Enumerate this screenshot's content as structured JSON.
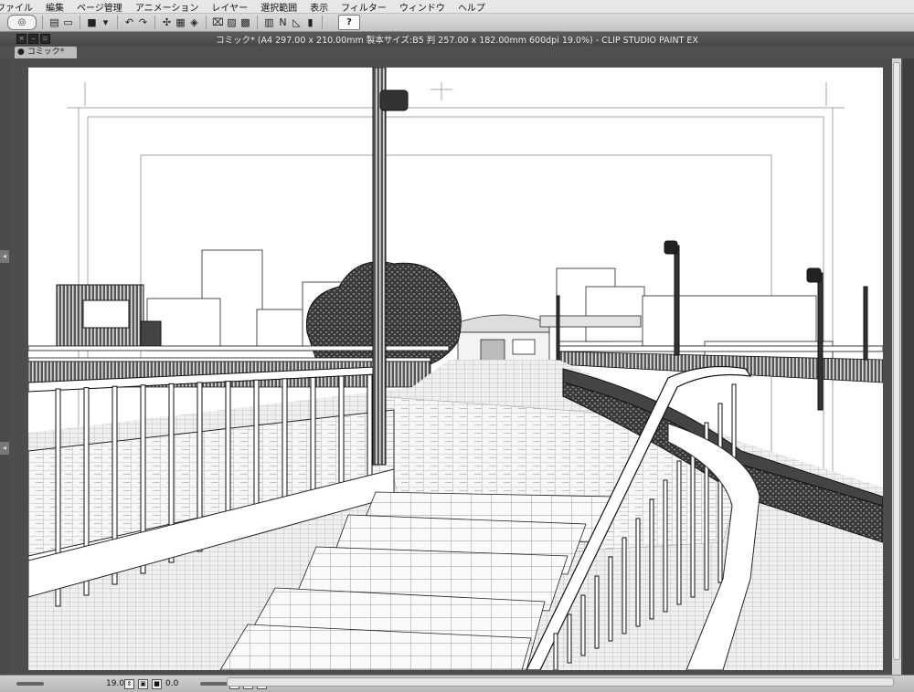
{
  "menu": [
    "ファイル",
    "編集",
    "ページ管理",
    "アニメーション",
    "レイヤー",
    "選択範囲",
    "表示",
    "フィルター",
    "ウィンドウ",
    "ヘルプ"
  ],
  "toolbar": {
    "items": [
      {
        "name": "new-file-icon",
        "glyph": "▤"
      },
      {
        "name": "open-folder-icon",
        "glyph": "▭"
      },
      {
        "name": "save-icon",
        "glyph": "■"
      },
      {
        "name": "save-dropdown-icon",
        "glyph": "▾"
      },
      {
        "name": "undo-icon",
        "glyph": "↶"
      },
      {
        "name": "redo-icon",
        "glyph": "↷"
      },
      {
        "name": "selection-launcher-icon",
        "glyph": "✣"
      },
      {
        "name": "transform-icon",
        "glyph": "▦"
      },
      {
        "name": "fill-bucket-icon",
        "glyph": "◈"
      },
      {
        "name": "deselect-icon",
        "glyph": "⌧"
      },
      {
        "name": "clear-icon",
        "glyph": "▨"
      },
      {
        "name": "fill-icon",
        "glyph": "▩"
      },
      {
        "name": "layer-icon",
        "glyph": "▥"
      },
      {
        "name": "snap-ruler-icon",
        "glyph": "N"
      },
      {
        "name": "snap-guide-icon",
        "glyph": "◺"
      },
      {
        "name": "snap-special-ruler-icon",
        "glyph": "▮"
      }
    ],
    "help_label": "?"
  },
  "window": {
    "title": "コミック* (A4 297.00 x 210.00mm 製本サイズ:B5 判 257.00 x 182.00mm 600dpi 19.0%)  - CLIP STUDIO PAINT EX"
  },
  "tabs": [
    {
      "label": "● コミック*"
    }
  ],
  "status": {
    "zoom": "19.0",
    "angle": "0.0"
  },
  "colors": {
    "menubar": "#e9e6e6",
    "titlebar": "#4f4f4f",
    "workspace": "#4d4d4d",
    "page": "#ffffff",
    "frame_lines": "#8a8aaa"
  }
}
